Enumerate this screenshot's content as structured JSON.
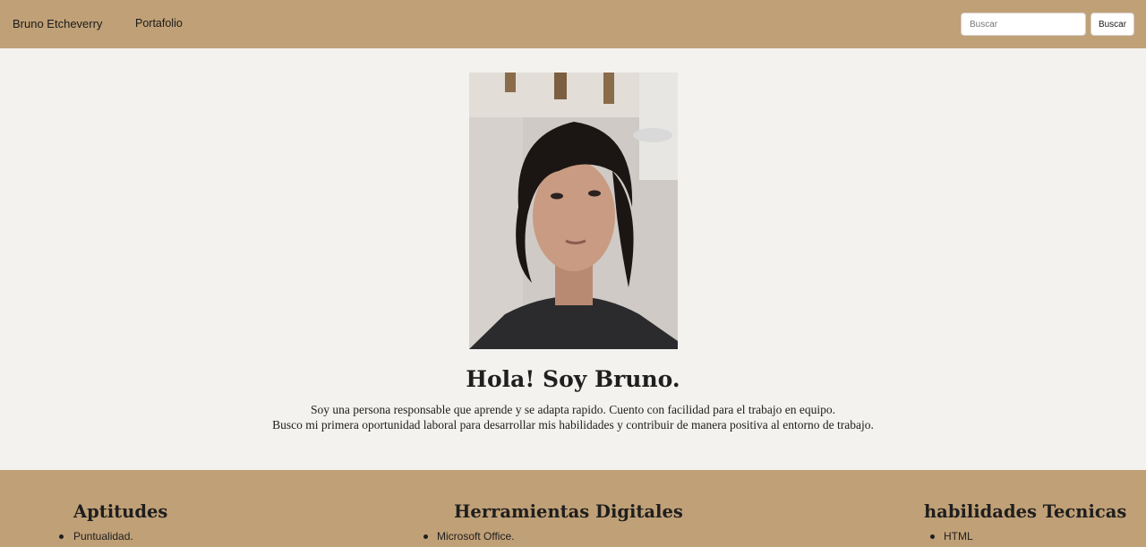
{
  "navbar": {
    "brand": "Bruno Etcheverry",
    "links": [
      {
        "label": "Portafolio"
      }
    ],
    "search": {
      "placeholder": "Buscar",
      "value": "",
      "button_label": "Buscar"
    }
  },
  "hero": {
    "title": "Hola! Soy Bruno.",
    "paragraph_lines": [
      "Soy una persona responsable que aprende y se adapta rapido. Cuento con facilidad para el trabajo en equipo.",
      "Busco mi primera oportunidad laboral para desarrollar mis habilidades y contribuir de manera positiva al entorno de trabajo."
    ]
  },
  "skills": {
    "columns": [
      {
        "title": "Aptitudes",
        "items": [
          "Puntualidad."
        ]
      },
      {
        "title": "Herramientas Digitales",
        "items": [
          "Microsoft Office."
        ]
      },
      {
        "title": "habilidades Tecnicas",
        "items": [
          "HTML"
        ]
      }
    ]
  },
  "colors": {
    "accent": "#c0a077",
    "background": "#f4f2ee",
    "text": "#1e1e1e"
  }
}
